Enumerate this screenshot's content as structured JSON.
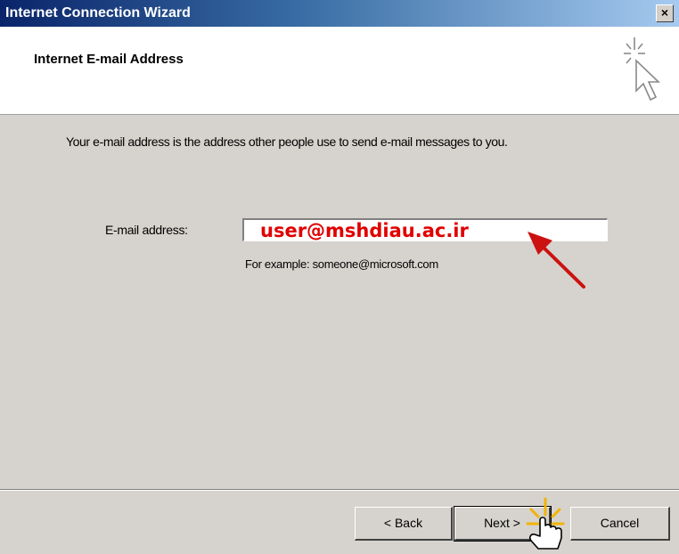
{
  "window": {
    "title": "Internet Connection Wizard",
    "close_glyph": "×"
  },
  "header": {
    "title": "Internet E-mail Address",
    "icon": "wizard-cursor-sparkle-icon"
  },
  "body": {
    "intro": "Your e-mail address is the address other people use to send e-mail messages to you.",
    "email_label": "E-mail address:",
    "email_value": "user@mshdiau.ac.ir",
    "example": "For example: someone@microsoft.com"
  },
  "buttons": {
    "back": "< Back",
    "next": "Next >",
    "cancel": "Cancel"
  },
  "annotations": {
    "arrow_color": "#cc1111",
    "value_color": "#e00000",
    "icon": "hand-pointer-icon"
  }
}
